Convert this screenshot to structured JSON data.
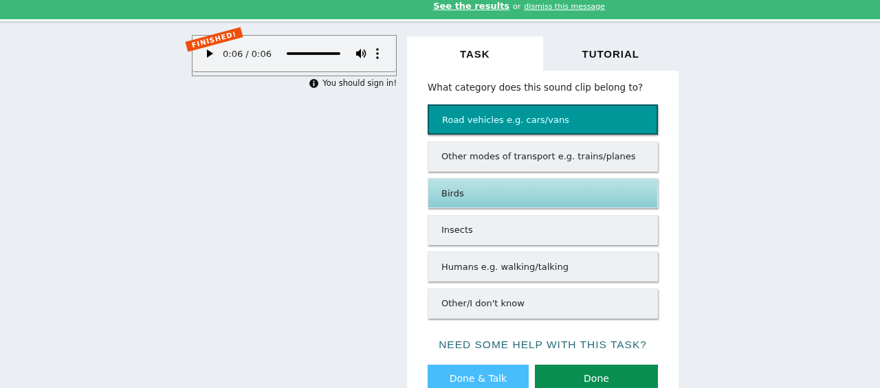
{
  "banner": {
    "link": "See the results",
    "separator": "or",
    "dismiss": "dismiss this message"
  },
  "player": {
    "badge": "FINISHED!",
    "time": "0:06 / 0:06",
    "level": 1
  },
  "sign_in": "You should sign in!",
  "tabs": [
    {
      "label": "TASK",
      "selected": true
    },
    {
      "label": "TUTORIAL",
      "selected": false
    }
  ],
  "question": "What category does this sound clip belong to?",
  "options": [
    {
      "label": "Road vehicles e.g. cars/vans",
      "selected": true,
      "hovered": false
    },
    {
      "label": "Other modes of transport e.g. trains/planes",
      "selected": false,
      "hovered": false
    },
    {
      "label": "Birds",
      "selected": false,
      "hovered": true
    },
    {
      "label": "Insects",
      "selected": false,
      "hovered": false
    },
    {
      "label": "Humans e.g. walking/talking",
      "selected": false,
      "hovered": false
    },
    {
      "label": "Other/I don't know",
      "selected": false,
      "hovered": false
    }
  ],
  "help": "NEED SOME HELP WITH THIS TASK?",
  "buttons": [
    {
      "label": "Done & Talk",
      "kind": "talk"
    },
    {
      "label": "Done",
      "kind": "done"
    }
  ]
}
